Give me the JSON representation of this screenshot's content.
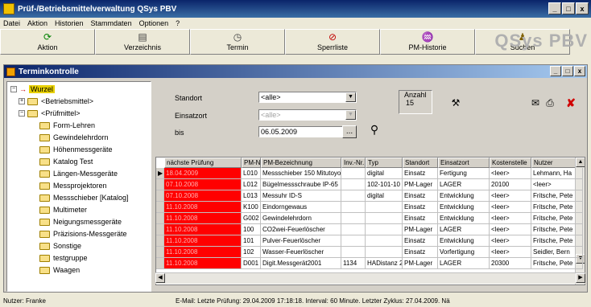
{
  "window": {
    "title": "Prüf-/Betriebsmittelverwaltung QSys PBV",
    "min": "_",
    "max": "□",
    "close": "x"
  },
  "menu": [
    "Datei",
    "Aktion",
    "Historien",
    "Stammdaten",
    "Optionen",
    "?"
  ],
  "toolbar": [
    {
      "label": "Aktion",
      "icon": "refresh-icon",
      "glyph": "⟳",
      "color": "#008000"
    },
    {
      "label": "Verzeichnis",
      "icon": "list-icon",
      "glyph": "▤",
      "color": "#404040"
    },
    {
      "label": "Termin",
      "icon": "clock-icon",
      "glyph": "◷",
      "color": "#404040"
    },
    {
      "label": "Sperrliste",
      "icon": "block-icon",
      "glyph": "⊘",
      "color": "#c00000"
    },
    {
      "label": "PM-Historie",
      "icon": "history-icon",
      "glyph": "♒",
      "color": "#404080"
    },
    {
      "label": "Suchen",
      "icon": "search-people-icon",
      "glyph": "♟",
      "color": "#806000"
    }
  ],
  "logo": "QSys PBV",
  "child": {
    "title": "Terminkontrolle"
  },
  "tree": {
    "root": "Wurzel",
    "betriebsmittel": "<Betriebsmittel>",
    "pruefmittel": "<Prüfmittel>",
    "items": [
      "Form-Lehren",
      "Gewindelehrdorn",
      "Höhenmessgeräte",
      "Katalog Test",
      "Längen-Messgeräte",
      "Messprojektoren",
      "Messschieber [Katalog]",
      "Multimeter",
      "Neigungsmessgeräte",
      "Präzisions-Messgeräte",
      "Sonstige",
      "testgruppe",
      "Waagen"
    ]
  },
  "filter": {
    "standort_label": "Standort",
    "standort_value": "<alle>",
    "einsatzort_label": "Einsatzort",
    "einsatzort_value": "<alle>",
    "bis_label": "bis",
    "bis_value": "06.05.2009",
    "browse": "...",
    "anzahl_label": "Anzahl",
    "anzahl_value": "15"
  },
  "grid": {
    "columns": [
      "nächste Prüfung",
      "PM-Nr.",
      "PM-Bezeichnung",
      "Inv.-Nr.",
      "Typ",
      "Standort",
      "Einsatzort",
      "Kostenstelle",
      "Nutzer"
    ],
    "rows": [
      [
        "18.04.2009",
        "L010",
        "Messschieber 150 Mitutoyo",
        "",
        "digital",
        "Einsatz",
        "Fertigung",
        "<leer>",
        "Lehmann, Ha"
      ],
      [
        "07.10.2008",
        "L012",
        "Bügelmessschraube IP-65",
        "",
        "102-101-10",
        "PM-Lager",
        "LAGER",
        "20100",
        "<leer>"
      ],
      [
        "07.10.2008",
        "L013",
        "Messuhr ID-S",
        "",
        "digital",
        "Einsatz",
        "Entwicklung",
        "<leer>",
        "Fritsche, Pete"
      ],
      [
        "11.10.2008",
        "K100",
        "Eindorngewaus",
        "",
        "",
        "Einsatz",
        "Entwicklung",
        "<leer>",
        "Fritsche, Pete"
      ],
      [
        "11.10.2008",
        "G002",
        "Gewindelehrdorn",
        "",
        "",
        "Einsatz",
        "Entwicklung",
        "<leer>",
        "Fritsche, Pete"
      ],
      [
        "11.10.2008",
        "100",
        "CO2wei-Feuerlöscher",
        "",
        "",
        "PM-Lager",
        "LAGER",
        "<leer>",
        "Fritsche, Pete"
      ],
      [
        "11.10.2008",
        "101",
        "Pulver-Feuerlöscher",
        "",
        "",
        "Einsatz",
        "Entwicklung",
        "<leer>",
        "Fritsche, Pete"
      ],
      [
        "11.10.2008",
        "102",
        "Wasser-Feuerlöscher",
        "",
        "",
        "Einsatz",
        "Vorfertigung",
        "<leer>",
        "Seidler, Bern"
      ],
      [
        "11.10.2008",
        "D001",
        "Digit.Messgerät2001",
        "1134",
        "HADistanz 2",
        "PM-Lager",
        "LAGER",
        "20300",
        "Fritsche, Pete"
      ]
    ]
  },
  "status": {
    "user_label": "Nutzer: Franke",
    "message": "E-Mail: Letzte Prüfung: 29.04.2009 17:18:18. Interval: 60 Minute. Letzter Zyklus: 27.04.2009. Nä"
  }
}
